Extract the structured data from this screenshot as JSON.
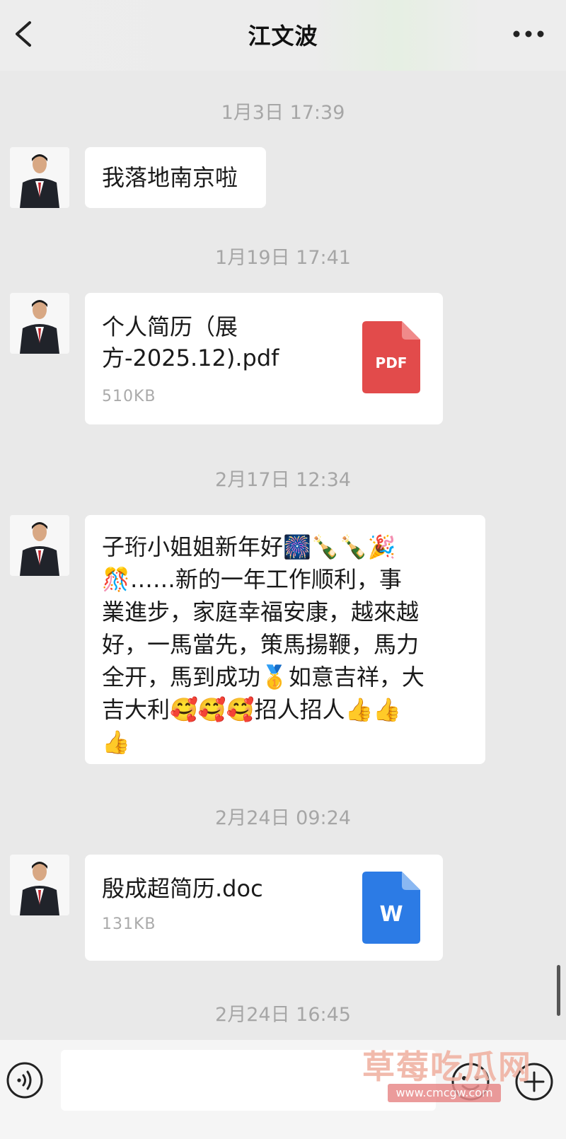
{
  "header": {
    "title": "江文波",
    "back_icon": "chevron-left-icon",
    "more_icon": "more-dots-icon"
  },
  "messages": [
    {
      "timestamp": "1月3日 17:39",
      "type": "text",
      "text": "我落地南京啦"
    },
    {
      "timestamp": "1月19日 17:41",
      "type": "file",
      "file_name": "个人简历（展\n方-2025.12).pdf",
      "file_size": "510KB",
      "file_type": "PDF",
      "icon_color": "#e24b4b"
    },
    {
      "timestamp": "2月17日 12:34",
      "type": "text",
      "lines": [
        "子珩小姐姐新年好🎆🍾🍾🎉",
        "🎊……新的一年工作顺利，事",
        "業進步，家庭幸福安康，越來越",
        "好，一馬當先，策馬揚鞭，馬力",
        "全开，馬到成功🥇如意吉祥，大",
        "吉大利🥰🥰🥰招人招人👍👍",
        "👍"
      ]
    },
    {
      "timestamp": "2月24日 09:24",
      "type": "file",
      "file_name": "殷成超简历.doc",
      "file_size": "131KB",
      "file_type": "W",
      "icon_color": "#2c7be5"
    },
    {
      "timestamp": "2月24日 16:45"
    }
  ],
  "input_bar": {
    "placeholder": "",
    "voice_icon": "voice-icon",
    "emoji_icon": "emoji-icon",
    "plus_icon": "plus-icon"
  },
  "watermark": {
    "text": "草莓吃瓜网",
    "url": "www.cmcgw.com"
  }
}
